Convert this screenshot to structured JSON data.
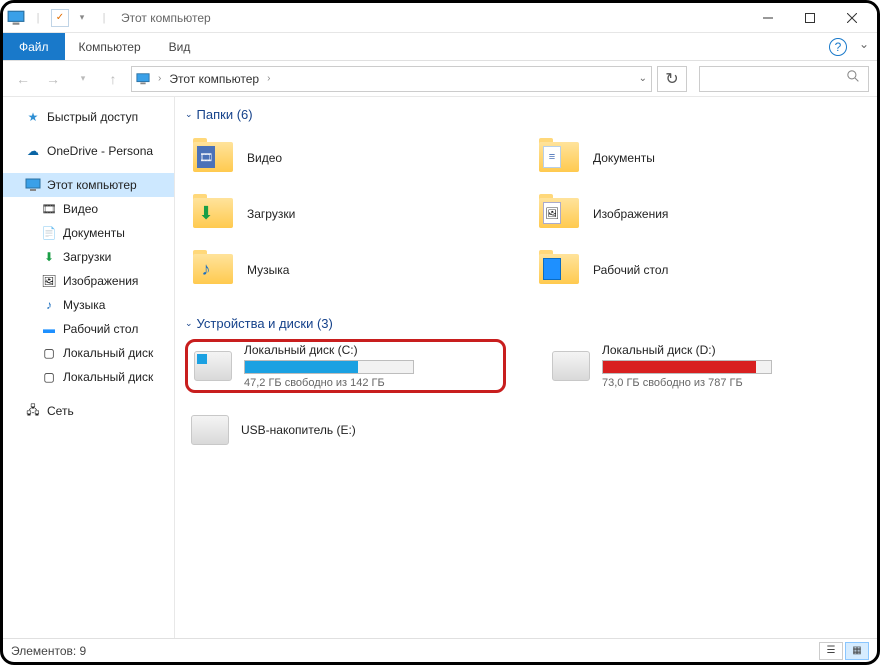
{
  "titlebar": {
    "title": "Этот компьютер"
  },
  "ribbon": {
    "file": "Файл",
    "tabs": [
      "Компьютер",
      "Вид"
    ]
  },
  "nav": {
    "crumb": "Этот компьютер"
  },
  "sidebar": {
    "quick": "Быстрый доступ",
    "onedrive": "OneDrive - Persona",
    "thispc": "Этот компьютер",
    "children": [
      {
        "label": "Видео"
      },
      {
        "label": "Документы"
      },
      {
        "label": "Загрузки"
      },
      {
        "label": "Изображения"
      },
      {
        "label": "Музыка"
      },
      {
        "label": "Рабочий стол"
      },
      {
        "label": "Локальный диск"
      },
      {
        "label": "Локальный диск"
      }
    ],
    "network": "Сеть"
  },
  "groups": {
    "folders": {
      "title": "Папки (6)"
    },
    "drives": {
      "title": "Устройства и диски (3)"
    }
  },
  "folders": [
    {
      "label": "Видео"
    },
    {
      "label": "Документы"
    },
    {
      "label": "Загрузки"
    },
    {
      "label": "Изображения"
    },
    {
      "label": "Музыка"
    },
    {
      "label": "Рабочий стол"
    }
  ],
  "drives": [
    {
      "name": "Локальный диск (C:)",
      "free": "47,2 ГБ свободно из 142 ГБ",
      "fillPct": 67,
      "color": "#1ba1e2",
      "highlight": true,
      "hasBar": true
    },
    {
      "name": "Локальный диск (D:)",
      "free": "73,0 ГБ свободно из 787 ГБ",
      "fillPct": 91,
      "color": "#d82020",
      "highlight": false,
      "hasBar": true
    },
    {
      "name": "USB-накопитель (E:)",
      "free": "",
      "fillPct": 0,
      "color": "#ccc",
      "highlight": false,
      "hasBar": false
    }
  ],
  "status": {
    "label": "Элементов: 9"
  }
}
